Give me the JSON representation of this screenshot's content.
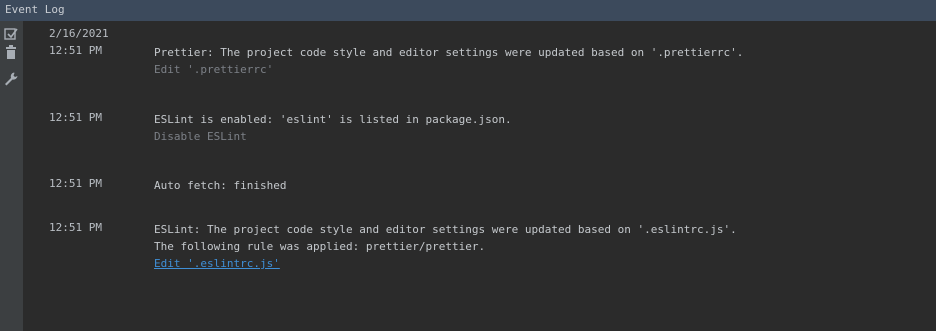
{
  "window": {
    "title": "Event Log"
  },
  "toolbar": {
    "icons": [
      "mark-read-icon",
      "trash-icon",
      "wrench-icon"
    ]
  },
  "log": {
    "date": "2/16/2021",
    "entries": [
      {
        "time": "12:51 PM",
        "lines": [
          "Prettier: The project code style and editor settings were updated based on '.prettierrc'."
        ],
        "action": "Edit '.prettierrc'"
      },
      {
        "time": "12:51 PM",
        "lines": [
          "ESLint is enabled: 'eslint' is listed in package.json."
        ],
        "action": "Disable ESLint"
      },
      {
        "time": "12:51 PM",
        "lines": [
          "Auto fetch: finished"
        ],
        "action": ""
      },
      {
        "time": "12:51 PM",
        "lines": [
          "ESLint: The project code style and editor settings were updated based on '.eslintrc.js'.",
          "The following rule was applied: prettier/prettier."
        ],
        "action": "Edit '.eslintrc.js'"
      }
    ]
  },
  "colors": {
    "background": "#2b2b2b",
    "titlebar": "#3c4a5c",
    "text": "#c4c8cc",
    "muted_action": "#7c8087",
    "link": "#3f8fd6"
  }
}
